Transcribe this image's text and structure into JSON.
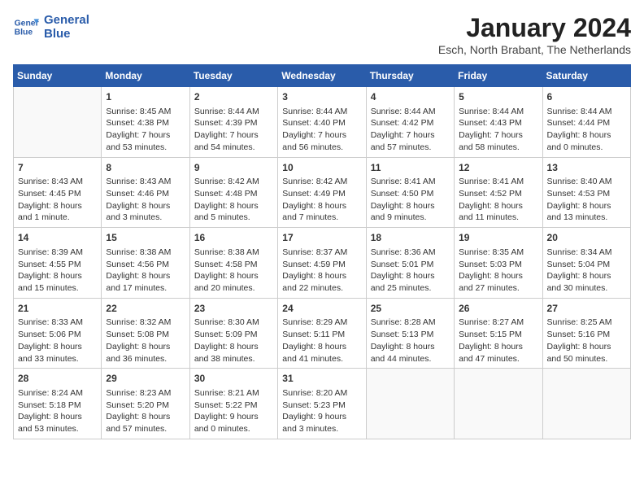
{
  "logo": {
    "line1": "General",
    "line2": "Blue"
  },
  "title": "January 2024",
  "subtitle": "Esch, North Brabant, The Netherlands",
  "weekdays": [
    "Sunday",
    "Monday",
    "Tuesday",
    "Wednesday",
    "Thursday",
    "Friday",
    "Saturday"
  ],
  "weeks": [
    [
      {
        "day": "",
        "sunrise": "",
        "sunset": "",
        "daylight": ""
      },
      {
        "day": "1",
        "sunrise": "Sunrise: 8:45 AM",
        "sunset": "Sunset: 4:38 PM",
        "daylight": "Daylight: 7 hours and 53 minutes."
      },
      {
        "day": "2",
        "sunrise": "Sunrise: 8:44 AM",
        "sunset": "Sunset: 4:39 PM",
        "daylight": "Daylight: 7 hours and 54 minutes."
      },
      {
        "day": "3",
        "sunrise": "Sunrise: 8:44 AM",
        "sunset": "Sunset: 4:40 PM",
        "daylight": "Daylight: 7 hours and 56 minutes."
      },
      {
        "day": "4",
        "sunrise": "Sunrise: 8:44 AM",
        "sunset": "Sunset: 4:42 PM",
        "daylight": "Daylight: 7 hours and 57 minutes."
      },
      {
        "day": "5",
        "sunrise": "Sunrise: 8:44 AM",
        "sunset": "Sunset: 4:43 PM",
        "daylight": "Daylight: 7 hours and 58 minutes."
      },
      {
        "day": "6",
        "sunrise": "Sunrise: 8:44 AM",
        "sunset": "Sunset: 4:44 PM",
        "daylight": "Daylight: 8 hours and 0 minutes."
      }
    ],
    [
      {
        "day": "7",
        "sunrise": "Sunrise: 8:43 AM",
        "sunset": "Sunset: 4:45 PM",
        "daylight": "Daylight: 8 hours and 1 minute."
      },
      {
        "day": "8",
        "sunrise": "Sunrise: 8:43 AM",
        "sunset": "Sunset: 4:46 PM",
        "daylight": "Daylight: 8 hours and 3 minutes."
      },
      {
        "day": "9",
        "sunrise": "Sunrise: 8:42 AM",
        "sunset": "Sunset: 4:48 PM",
        "daylight": "Daylight: 8 hours and 5 minutes."
      },
      {
        "day": "10",
        "sunrise": "Sunrise: 8:42 AM",
        "sunset": "Sunset: 4:49 PM",
        "daylight": "Daylight: 8 hours and 7 minutes."
      },
      {
        "day": "11",
        "sunrise": "Sunrise: 8:41 AM",
        "sunset": "Sunset: 4:50 PM",
        "daylight": "Daylight: 8 hours and 9 minutes."
      },
      {
        "day": "12",
        "sunrise": "Sunrise: 8:41 AM",
        "sunset": "Sunset: 4:52 PM",
        "daylight": "Daylight: 8 hours and 11 minutes."
      },
      {
        "day": "13",
        "sunrise": "Sunrise: 8:40 AM",
        "sunset": "Sunset: 4:53 PM",
        "daylight": "Daylight: 8 hours and 13 minutes."
      }
    ],
    [
      {
        "day": "14",
        "sunrise": "Sunrise: 8:39 AM",
        "sunset": "Sunset: 4:55 PM",
        "daylight": "Daylight: 8 hours and 15 minutes."
      },
      {
        "day": "15",
        "sunrise": "Sunrise: 8:38 AM",
        "sunset": "Sunset: 4:56 PM",
        "daylight": "Daylight: 8 hours and 17 minutes."
      },
      {
        "day": "16",
        "sunrise": "Sunrise: 8:38 AM",
        "sunset": "Sunset: 4:58 PM",
        "daylight": "Daylight: 8 hours and 20 minutes."
      },
      {
        "day": "17",
        "sunrise": "Sunrise: 8:37 AM",
        "sunset": "Sunset: 4:59 PM",
        "daylight": "Daylight: 8 hours and 22 minutes."
      },
      {
        "day": "18",
        "sunrise": "Sunrise: 8:36 AM",
        "sunset": "Sunset: 5:01 PM",
        "daylight": "Daylight: 8 hours and 25 minutes."
      },
      {
        "day": "19",
        "sunrise": "Sunrise: 8:35 AM",
        "sunset": "Sunset: 5:03 PM",
        "daylight": "Daylight: 8 hours and 27 minutes."
      },
      {
        "day": "20",
        "sunrise": "Sunrise: 8:34 AM",
        "sunset": "Sunset: 5:04 PM",
        "daylight": "Daylight: 8 hours and 30 minutes."
      }
    ],
    [
      {
        "day": "21",
        "sunrise": "Sunrise: 8:33 AM",
        "sunset": "Sunset: 5:06 PM",
        "daylight": "Daylight: 8 hours and 33 minutes."
      },
      {
        "day": "22",
        "sunrise": "Sunrise: 8:32 AM",
        "sunset": "Sunset: 5:08 PM",
        "daylight": "Daylight: 8 hours and 36 minutes."
      },
      {
        "day": "23",
        "sunrise": "Sunrise: 8:30 AM",
        "sunset": "Sunset: 5:09 PM",
        "daylight": "Daylight: 8 hours and 38 minutes."
      },
      {
        "day": "24",
        "sunrise": "Sunrise: 8:29 AM",
        "sunset": "Sunset: 5:11 PM",
        "daylight": "Daylight: 8 hours and 41 minutes."
      },
      {
        "day": "25",
        "sunrise": "Sunrise: 8:28 AM",
        "sunset": "Sunset: 5:13 PM",
        "daylight": "Daylight: 8 hours and 44 minutes."
      },
      {
        "day": "26",
        "sunrise": "Sunrise: 8:27 AM",
        "sunset": "Sunset: 5:15 PM",
        "daylight": "Daylight: 8 hours and 47 minutes."
      },
      {
        "day": "27",
        "sunrise": "Sunrise: 8:25 AM",
        "sunset": "Sunset: 5:16 PM",
        "daylight": "Daylight: 8 hours and 50 minutes."
      }
    ],
    [
      {
        "day": "28",
        "sunrise": "Sunrise: 8:24 AM",
        "sunset": "Sunset: 5:18 PM",
        "daylight": "Daylight: 8 hours and 53 minutes."
      },
      {
        "day": "29",
        "sunrise": "Sunrise: 8:23 AM",
        "sunset": "Sunset: 5:20 PM",
        "daylight": "Daylight: 8 hours and 57 minutes."
      },
      {
        "day": "30",
        "sunrise": "Sunrise: 8:21 AM",
        "sunset": "Sunset: 5:22 PM",
        "daylight": "Daylight: 9 hours and 0 minutes."
      },
      {
        "day": "31",
        "sunrise": "Sunrise: 8:20 AM",
        "sunset": "Sunset: 5:23 PM",
        "daylight": "Daylight: 9 hours and 3 minutes."
      },
      {
        "day": "",
        "sunrise": "",
        "sunset": "",
        "daylight": ""
      },
      {
        "day": "",
        "sunrise": "",
        "sunset": "",
        "daylight": ""
      },
      {
        "day": "",
        "sunrise": "",
        "sunset": "",
        "daylight": ""
      }
    ]
  ]
}
